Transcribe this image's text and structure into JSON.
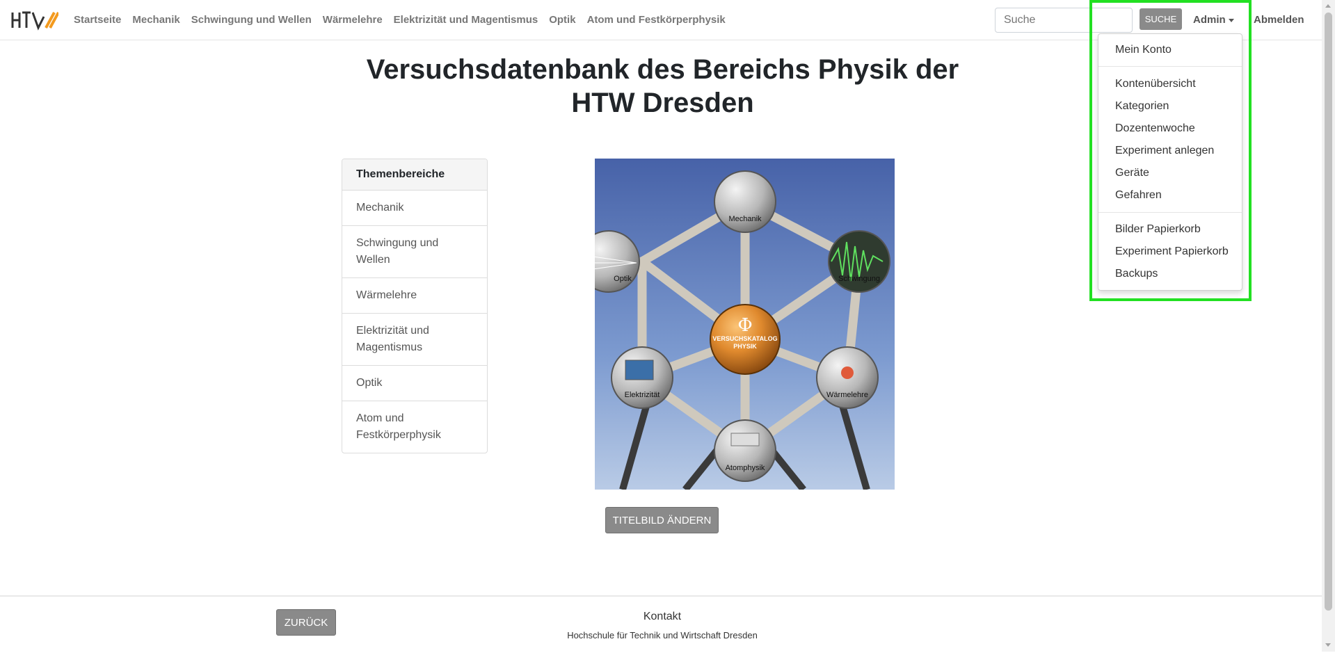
{
  "nav": {
    "logo_alt": "HTW",
    "links": [
      "Startseite",
      "Mechanik",
      "Schwingung und Wellen",
      "Wärmelehre",
      "Elektrizität und Magentismus",
      "Optik",
      "Atom und Festkörperphysik"
    ],
    "search_placeholder": "Suche",
    "search_button": "SUCHE",
    "admin_label": "Admin",
    "logout_label": "Abmelden"
  },
  "title": "Versuchsdatenbank des Bereichs Physik der HTW Dresden",
  "topics": {
    "header": "Themenbereiche",
    "items": [
      "Mechanik",
      "Schwingung und Wellen",
      "Wärmelehre",
      "Elektrizität und Magentismus",
      "Optik",
      "Atom und Festkörperphysik"
    ]
  },
  "hero": {
    "center_symbol": "Φ",
    "center_line1": "VERSUCHSKATALOG",
    "center_line2": "PHYSIK",
    "nodes": [
      "Mechanik",
      "Schwingung",
      "Wärmelehre",
      "Atomphysik",
      "Elektrizität",
      "Optik"
    ]
  },
  "change_image_button": "TITELBILD ÄNDERN",
  "dropdown": {
    "items": [
      "Mein Konto",
      "Kontenübersicht",
      "Kategorien",
      "Dozentenwoche",
      "Experiment anlegen",
      "Geräte",
      "Gefahren",
      "Bilder Papierkorb",
      "Experiment Papierkorb",
      "Backups"
    ]
  },
  "footer": {
    "back_button": "ZURÜCK",
    "contact": "Kontakt",
    "organization": "Hochschule für Technik und Wirtschaft Dresden"
  },
  "colors": {
    "highlight": "#22e022",
    "button_gray": "#8a8a8a",
    "sphere_orange": "#e08a2e",
    "sky_blue": "#4a6db0"
  }
}
